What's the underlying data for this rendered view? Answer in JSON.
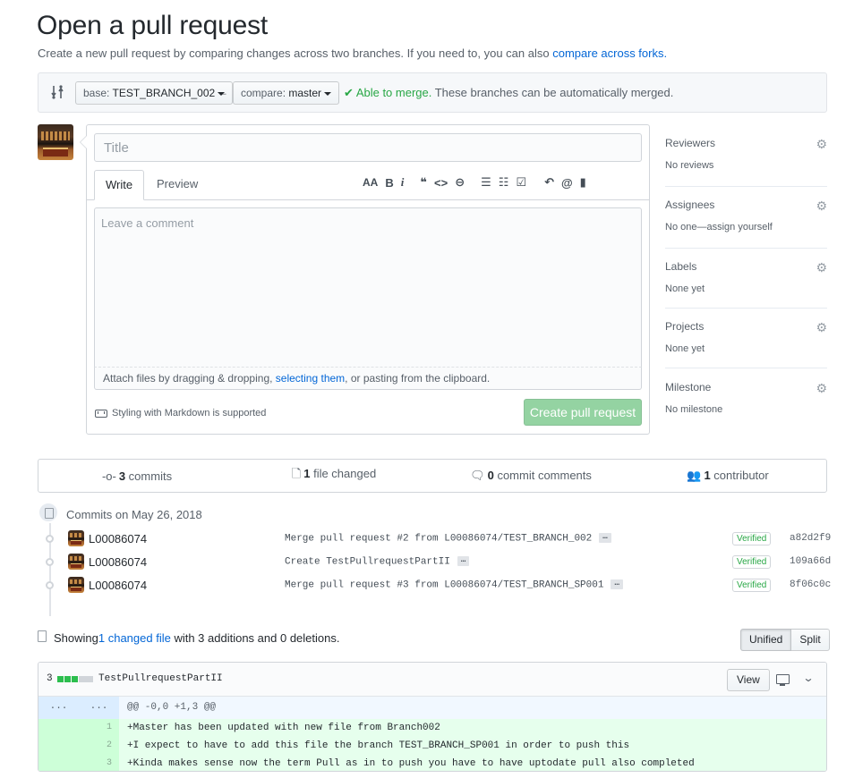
{
  "page": {
    "title": "Open a pull request",
    "subhead_text": "Create a new pull request by comparing changes across two branches. If you need to, you can also ",
    "subhead_link": "compare across forks."
  },
  "range": {
    "base_label": "base:",
    "base_value": "TEST_BRANCH_002",
    "compare_label": "compare:",
    "compare_value": "master",
    "merge_ok": "Able to merge.",
    "merge_desc": " These branches can be automatically merged."
  },
  "form": {
    "title_placeholder": "Title",
    "tabs": [
      "Write",
      "Preview"
    ],
    "toolbar": {
      "heading": "AA",
      "bold": "B",
      "italic": "i",
      "quote": "❝",
      "code": "<>",
      "link": "⊖",
      "ul": "☰",
      "ol": "☷",
      "task": "☑",
      "reply": "↶",
      "mention": "@",
      "saved": "▮"
    },
    "comment_placeholder": "Leave a comment",
    "attach_pre": "Attach files by dragging & dropping, ",
    "attach_link": "selecting them",
    "attach_post": ", or pasting from the clipboard.",
    "markdown_note": "Styling with Markdown is supported",
    "submit_label": "Create pull request"
  },
  "sidebar": [
    {
      "heading": "Reviewers",
      "value": "No reviews"
    },
    {
      "heading": "Assignees",
      "value": "No one—assign yourself"
    },
    {
      "heading": "Labels",
      "value": "None yet"
    },
    {
      "heading": "Projects",
      "value": "None yet"
    },
    {
      "heading": "Milestone",
      "value": "No milestone"
    }
  ],
  "stats": {
    "commits_num": "3",
    "commits_label": " commits",
    "files_num": "1",
    "files_label": " file changed",
    "comments_num": "0",
    "comments_label": " commit comments",
    "contrib_num": "1",
    "contrib_label": " contributor"
  },
  "commits": {
    "group_title": "Commits on May 26, 2018",
    "items": [
      {
        "author": "L00086074",
        "message": "Merge pull request #2 from L00086074/TEST_BRANCH_002",
        "badge": "Verified",
        "sha": "a82d2f9"
      },
      {
        "author": "L00086074",
        "message": "Create TestPullrequestPartII",
        "badge": "Verified",
        "sha": "109a66d"
      },
      {
        "author": "L00086074",
        "message": "Merge pull request #3 from L00086074/TEST_BRANCH_SP001",
        "badge": "Verified",
        "sha": "8f06c0c"
      }
    ]
  },
  "files": {
    "showing": "Showing ",
    "changed_link": "1 changed file",
    "with": " with ",
    "additions_num": "3",
    "additions_label": " additions",
    "and": " and ",
    "deletions_num": "0",
    "deletions_label": " deletions.",
    "unified_label": "Unified",
    "split_label": "Split"
  },
  "diff": {
    "count": "3",
    "filename": "TestPullrequestPartII",
    "view_label": "View",
    "hunk_old": "...",
    "hunk_new": "...",
    "hunk_header": "@@ -0,0 +1,3 @@",
    "lines": [
      {
        "num": "1",
        "code": "+Master has been updated with new file from Branch002"
      },
      {
        "num": "2",
        "code": "+I expect to have to add this file the branch TEST_BRANCH_SP001 in order to push this"
      },
      {
        "num": "3",
        "code": "+Kinda makes sense now the term Pull as in to push you have to have uptodate pull also completed"
      }
    ]
  },
  "colors": {
    "link": "#0366d6",
    "success": "#28a745",
    "create_button_disabled": "#94d3a2",
    "diff_add_bg": "#e6ffed"
  }
}
